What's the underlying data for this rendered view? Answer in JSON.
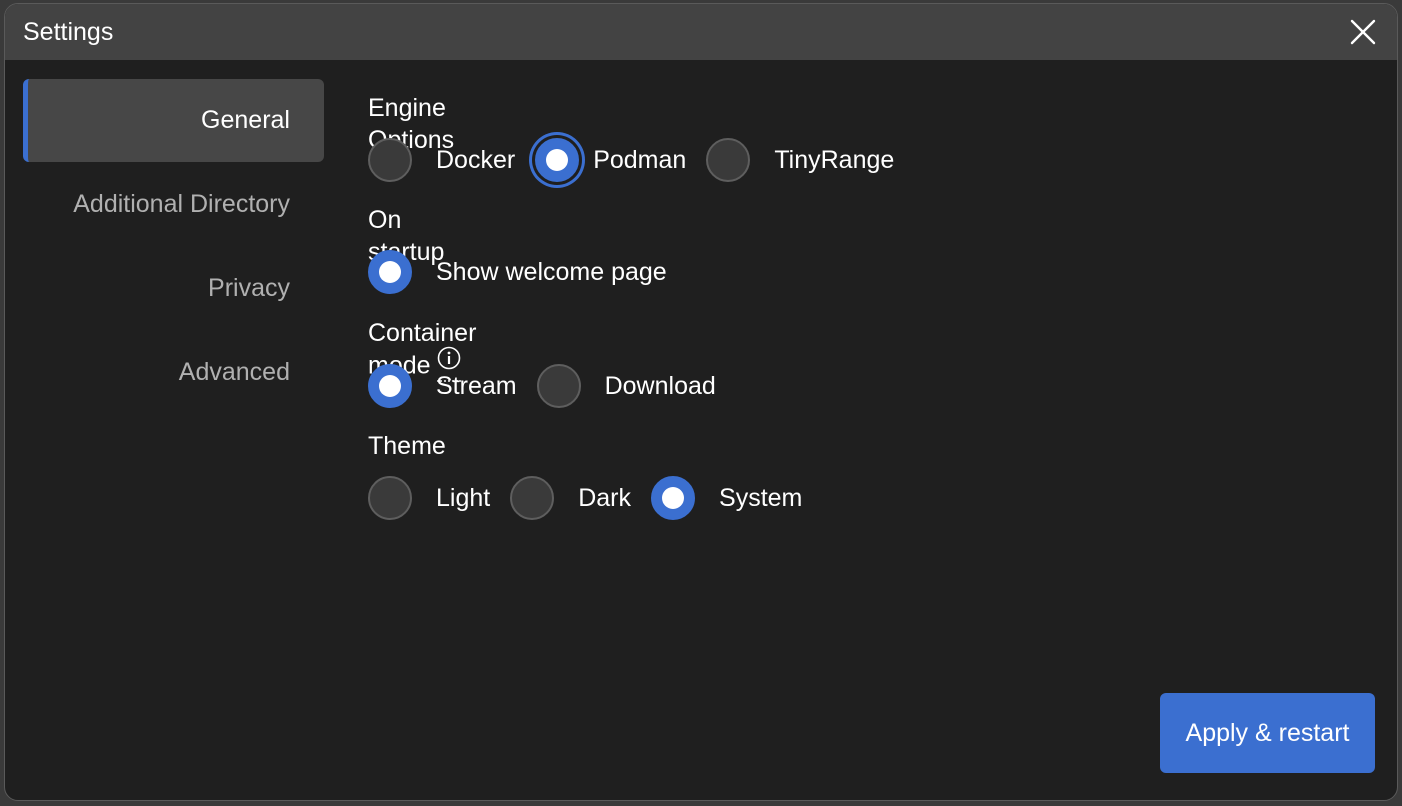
{
  "window": {
    "title": "Settings",
    "close_icon": "close-icon"
  },
  "sidebar": {
    "items": [
      {
        "label": "General",
        "active": true
      },
      {
        "label": "Additional Directory",
        "active": false
      },
      {
        "label": "Privacy",
        "active": false
      },
      {
        "label": "Advanced",
        "active": false
      }
    ]
  },
  "general": {
    "engine": {
      "label": "Engine Options",
      "options": [
        "Docker",
        "Podman",
        "TinyRange"
      ],
      "selected": "Podman"
    },
    "startup": {
      "label": "On startup",
      "options": [
        "Show welcome page"
      ],
      "selected": "Show welcome page"
    },
    "container_mode": {
      "label": "Container mode",
      "info_icon": "info-icon",
      "options": [
        "Stream",
        "Download"
      ],
      "selected": "Stream"
    },
    "theme": {
      "label": "Theme",
      "options": [
        "Light",
        "Dark",
        "System"
      ],
      "selected": "System"
    }
  },
  "footer": {
    "apply_label": "Apply & restart"
  },
  "colors": {
    "accent": "#3b6fd0",
    "background": "#1f1f1f",
    "titlebar": "#434343"
  }
}
